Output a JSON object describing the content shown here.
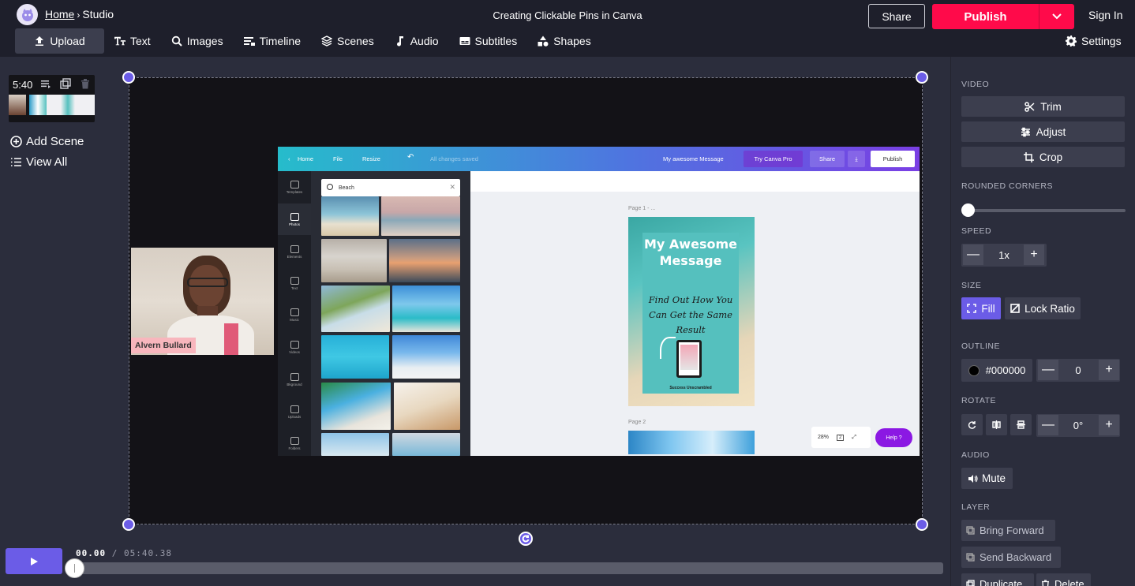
{
  "header": {
    "home_label": "Home",
    "breadcrumb_sep": "›",
    "studio_label": "Studio",
    "doc_title": "Creating Clickable Pins in Canva",
    "share_label": "Share",
    "publish_label": "Publish",
    "signin_label": "Sign In"
  },
  "toolbar": {
    "items": [
      {
        "label": "Upload",
        "icon": "upload-icon"
      },
      {
        "label": "Text",
        "icon": "text-icon"
      },
      {
        "label": "Images",
        "icon": "search-icon"
      },
      {
        "label": "Timeline",
        "icon": "timeline-icon"
      },
      {
        "label": "Scenes",
        "icon": "layers-icon"
      },
      {
        "label": "Audio",
        "icon": "music-note-icon"
      },
      {
        "label": "Subtitles",
        "icon": "subtitles-icon"
      },
      {
        "label": "Shapes",
        "icon": "shapes-icon"
      }
    ],
    "settings_label": "Settings"
  },
  "scenes": {
    "duration": "5:40",
    "add_scene_label": "Add Scene",
    "view_all_label": "View All"
  },
  "webcam": {
    "name_tag": "Alvern Bullard"
  },
  "canva": {
    "home": "Home",
    "file": "File",
    "resize": "Resize",
    "saved_status": "All changes saved",
    "doc_name": "My awesome Message",
    "try_pro": "Try Canva Pro",
    "share": "Share",
    "publish": "Publish",
    "search_value": "Beach",
    "sidebar": [
      "Templates",
      "Photos",
      "Elements",
      "Text",
      "Music",
      "Videos",
      "Bkground",
      "Uploads",
      "Folders"
    ],
    "page1_label": "Page 1 - ...",
    "page2_label": "Page 2",
    "pin_title": "My Awesome Message",
    "pin_sub": "Find Out How You Can Get the Same Result",
    "pin_footer": "Success Unscrambled",
    "zoom": "28%",
    "page_count": "2",
    "help": "Help ?"
  },
  "timeline": {
    "current": "00.00",
    "separator": "/",
    "total": "05:40.38",
    "progress": 0
  },
  "props": {
    "video_label": "VIDEO",
    "trim_label": "Trim",
    "adjust_label": "Adjust",
    "crop_label": "Crop",
    "rounded_label": "ROUNDED CORNERS",
    "rounded_value": 0,
    "speed_label": "SPEED",
    "speed_value": "1x",
    "size_label": "SIZE",
    "fill_label": "Fill",
    "lock_ratio_label": "Lock Ratio",
    "outline_label": "OUTLINE",
    "outline_color": "#000000",
    "outline_width": "0",
    "rotate_label": "ROTATE",
    "rotate_value": "0°",
    "audio_label": "AUDIO",
    "mute_label": "Mute",
    "layer_label": "LAYER",
    "bring_forward_label": "Bring Forward",
    "send_backward_label": "Send Backward",
    "duplicate_label": "Duplicate",
    "delete_label": "Delete",
    "minus_symbol": "—",
    "plus_symbol": "+"
  },
  "colors": {
    "accent": "#6b5ce7",
    "publish": "#ff0a4a",
    "canva_help": "#8b18e3"
  }
}
